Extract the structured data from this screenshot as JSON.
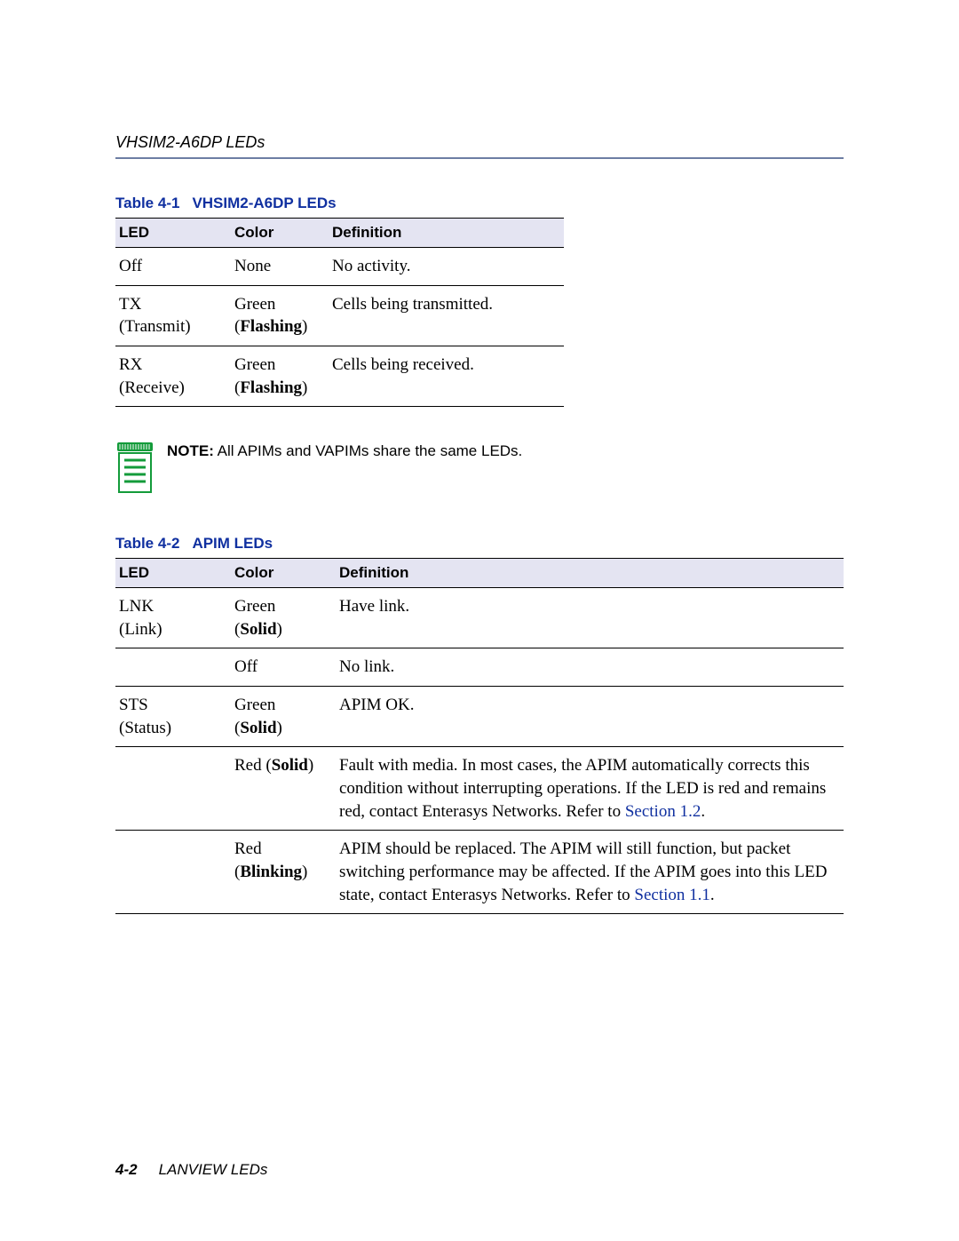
{
  "header": {
    "title": "VHSIM2-A6DP LEDs"
  },
  "table1": {
    "caption_num": "Table 4-1",
    "caption_title": "VHSIM2-A6DP LEDs",
    "headers": {
      "c1": "LED",
      "c2": "Color",
      "c3": "Definition"
    },
    "rows": [
      {
        "led_main": "Off",
        "led_sub": "",
        "color_main": "None",
        "color_mod": "",
        "def": "No activity."
      },
      {
        "led_main": "TX",
        "led_sub": "(Transmit)",
        "color_main": "Green",
        "color_mod": "Flashing",
        "def": "Cells being transmitted."
      },
      {
        "led_main": "RX",
        "led_sub": "(Receive)",
        "color_main": "Green",
        "color_mod": "Flashing",
        "def": "Cells being received."
      }
    ]
  },
  "note": {
    "label": "NOTE:",
    "text": " All APIMs and VAPIMs share the same LEDs."
  },
  "table2": {
    "caption_num": "Table 4-2",
    "caption_title": "APIM LEDs",
    "headers": {
      "c1": "LED",
      "c2": "Color",
      "c3": "Definition"
    },
    "r0_led_main": "LNK",
    "r0_led_sub": "(Link)",
    "r0_color_main": "Green",
    "r0_color_mod": "Solid",
    "r0_def": "Have link.",
    "r1_color_main": "Off",
    "r1_def": "No link.",
    "r2_led_main": "STS",
    "r2_led_sub": "(Status)",
    "r2_color_main": "Green",
    "r2_color_mod": "Solid",
    "r2_def": "APIM OK.",
    "r3_color_pre": "Red (",
    "r3_color_mod": "Solid",
    "r3_color_post": ")",
    "r3_def_a": "Fault with media. In most cases, the APIM automatically corrects this condition without interrupting operations. If the LED is red and remains red, contact Enterasys Networks. Refer to ",
    "r3_link": "Section 1.2",
    "r3_def_b": ".",
    "r4_color_main": "Red",
    "r4_color_mod": "Blinking",
    "r4_def_a": "APIM should be replaced. The APIM will still function, but packet switching performance may be affected. If the APIM goes into this LED state, contact Enterasys Networks. Refer to ",
    "r4_link": "Section 1.1",
    "r4_def_b": "."
  },
  "footer": {
    "page_num": "4-2",
    "section": "LANVIEW LEDs"
  }
}
